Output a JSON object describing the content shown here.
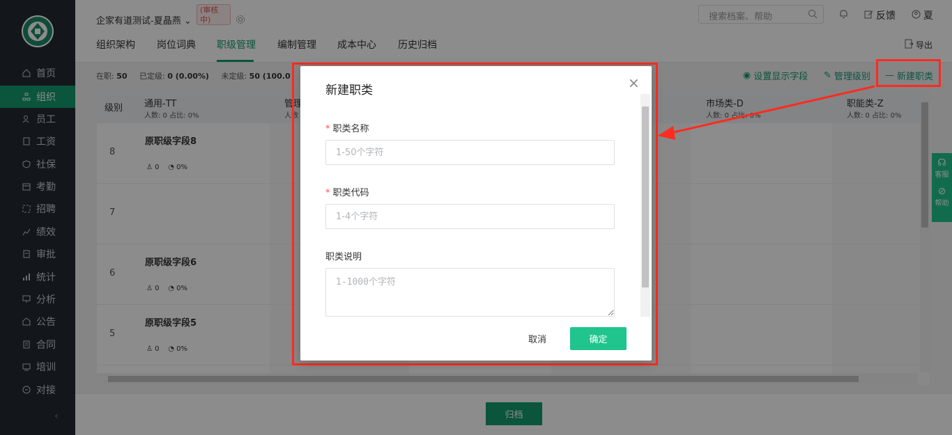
{
  "sidebar": {
    "items": [
      {
        "label": "首页",
        "icon": "home-icon"
      },
      {
        "label": "组织",
        "icon": "org-icon",
        "active": true
      },
      {
        "label": "员工",
        "icon": "staff-icon"
      },
      {
        "label": "工资",
        "icon": "salary-icon"
      },
      {
        "label": "社保",
        "icon": "shield-icon"
      },
      {
        "label": "考勤",
        "icon": "calendar-icon"
      },
      {
        "label": "招聘",
        "icon": "recruit-icon"
      },
      {
        "label": "绩效",
        "icon": "chart-icon"
      },
      {
        "label": "审批",
        "icon": "approve-icon"
      },
      {
        "label": "统计",
        "icon": "stats-icon"
      },
      {
        "label": "分析",
        "icon": "analysis-icon"
      },
      {
        "label": "公告",
        "icon": "notice-icon"
      },
      {
        "label": "合同",
        "icon": "contract-icon"
      },
      {
        "label": "培训",
        "icon": "training-icon"
      },
      {
        "label": "对接",
        "icon": "link-icon"
      }
    ],
    "active_color": "#139b6e"
  },
  "header": {
    "company": "企家有道测试-夏晶燕",
    "audit_badge": "(审核中)",
    "search_placeholder": "搜索档案、帮助",
    "feedback": "反馈",
    "user": "夏"
  },
  "tabs": [
    {
      "label": "组织架构"
    },
    {
      "label": "岗位词典"
    },
    {
      "label": "职级管理",
      "active": true
    },
    {
      "label": "编制管理"
    },
    {
      "label": "成本中心"
    },
    {
      "label": "历史归档"
    }
  ],
  "export_label": "导出",
  "stats": {
    "in_service_label": "在职:",
    "in_service_value": "50",
    "graded_label": "已定级:",
    "graded_value": "0 (0.00%)",
    "ungraded_label": "未定级:",
    "ungraded_value": "50 (100.0"
  },
  "actions": {
    "display_fields": "设置显示字段",
    "manage_grades": "管理级别",
    "new_category": "新建职类"
  },
  "table": {
    "grade_header": "级别",
    "columns": [
      {
        "name": "通用-TT",
        "meta": "人数: 0 占比: 0%"
      },
      {
        "name": "管理",
        "meta": "人数"
      },
      {
        "name": "市场类-D",
        "meta": "人数: 0 占比: 0%"
      },
      {
        "name": "职能类-Z",
        "meta": "人数: 0 占比: 0%"
      }
    ],
    "rows": [
      {
        "grade": "8",
        "job": "原职级字段8",
        "count": "0",
        "ratio": "0%"
      },
      {
        "grade": "7",
        "job": "",
        "count": "",
        "ratio": ""
      },
      {
        "grade": "6",
        "job": "原职级字段6",
        "count": "0",
        "ratio": "0%"
      },
      {
        "grade": "5",
        "job": "原职级字段5",
        "count": "0",
        "ratio": "0%"
      }
    ]
  },
  "footer": {
    "archive": "归档"
  },
  "side_help": {
    "service": "客服",
    "help": "帮助"
  },
  "modal": {
    "title": "新建职类",
    "name_label": "职类名称",
    "name_placeholder": "1-50个字符",
    "code_label": "职类代码",
    "code_placeholder": "1-4个字符",
    "desc_label": "职类说明",
    "desc_placeholder": "1-1000个字符",
    "cancel": "取消",
    "confirm": "确定"
  },
  "colors": {
    "brand": "#139b6e",
    "confirm": "#1fc58d",
    "highlight": "#ff2b1f"
  }
}
